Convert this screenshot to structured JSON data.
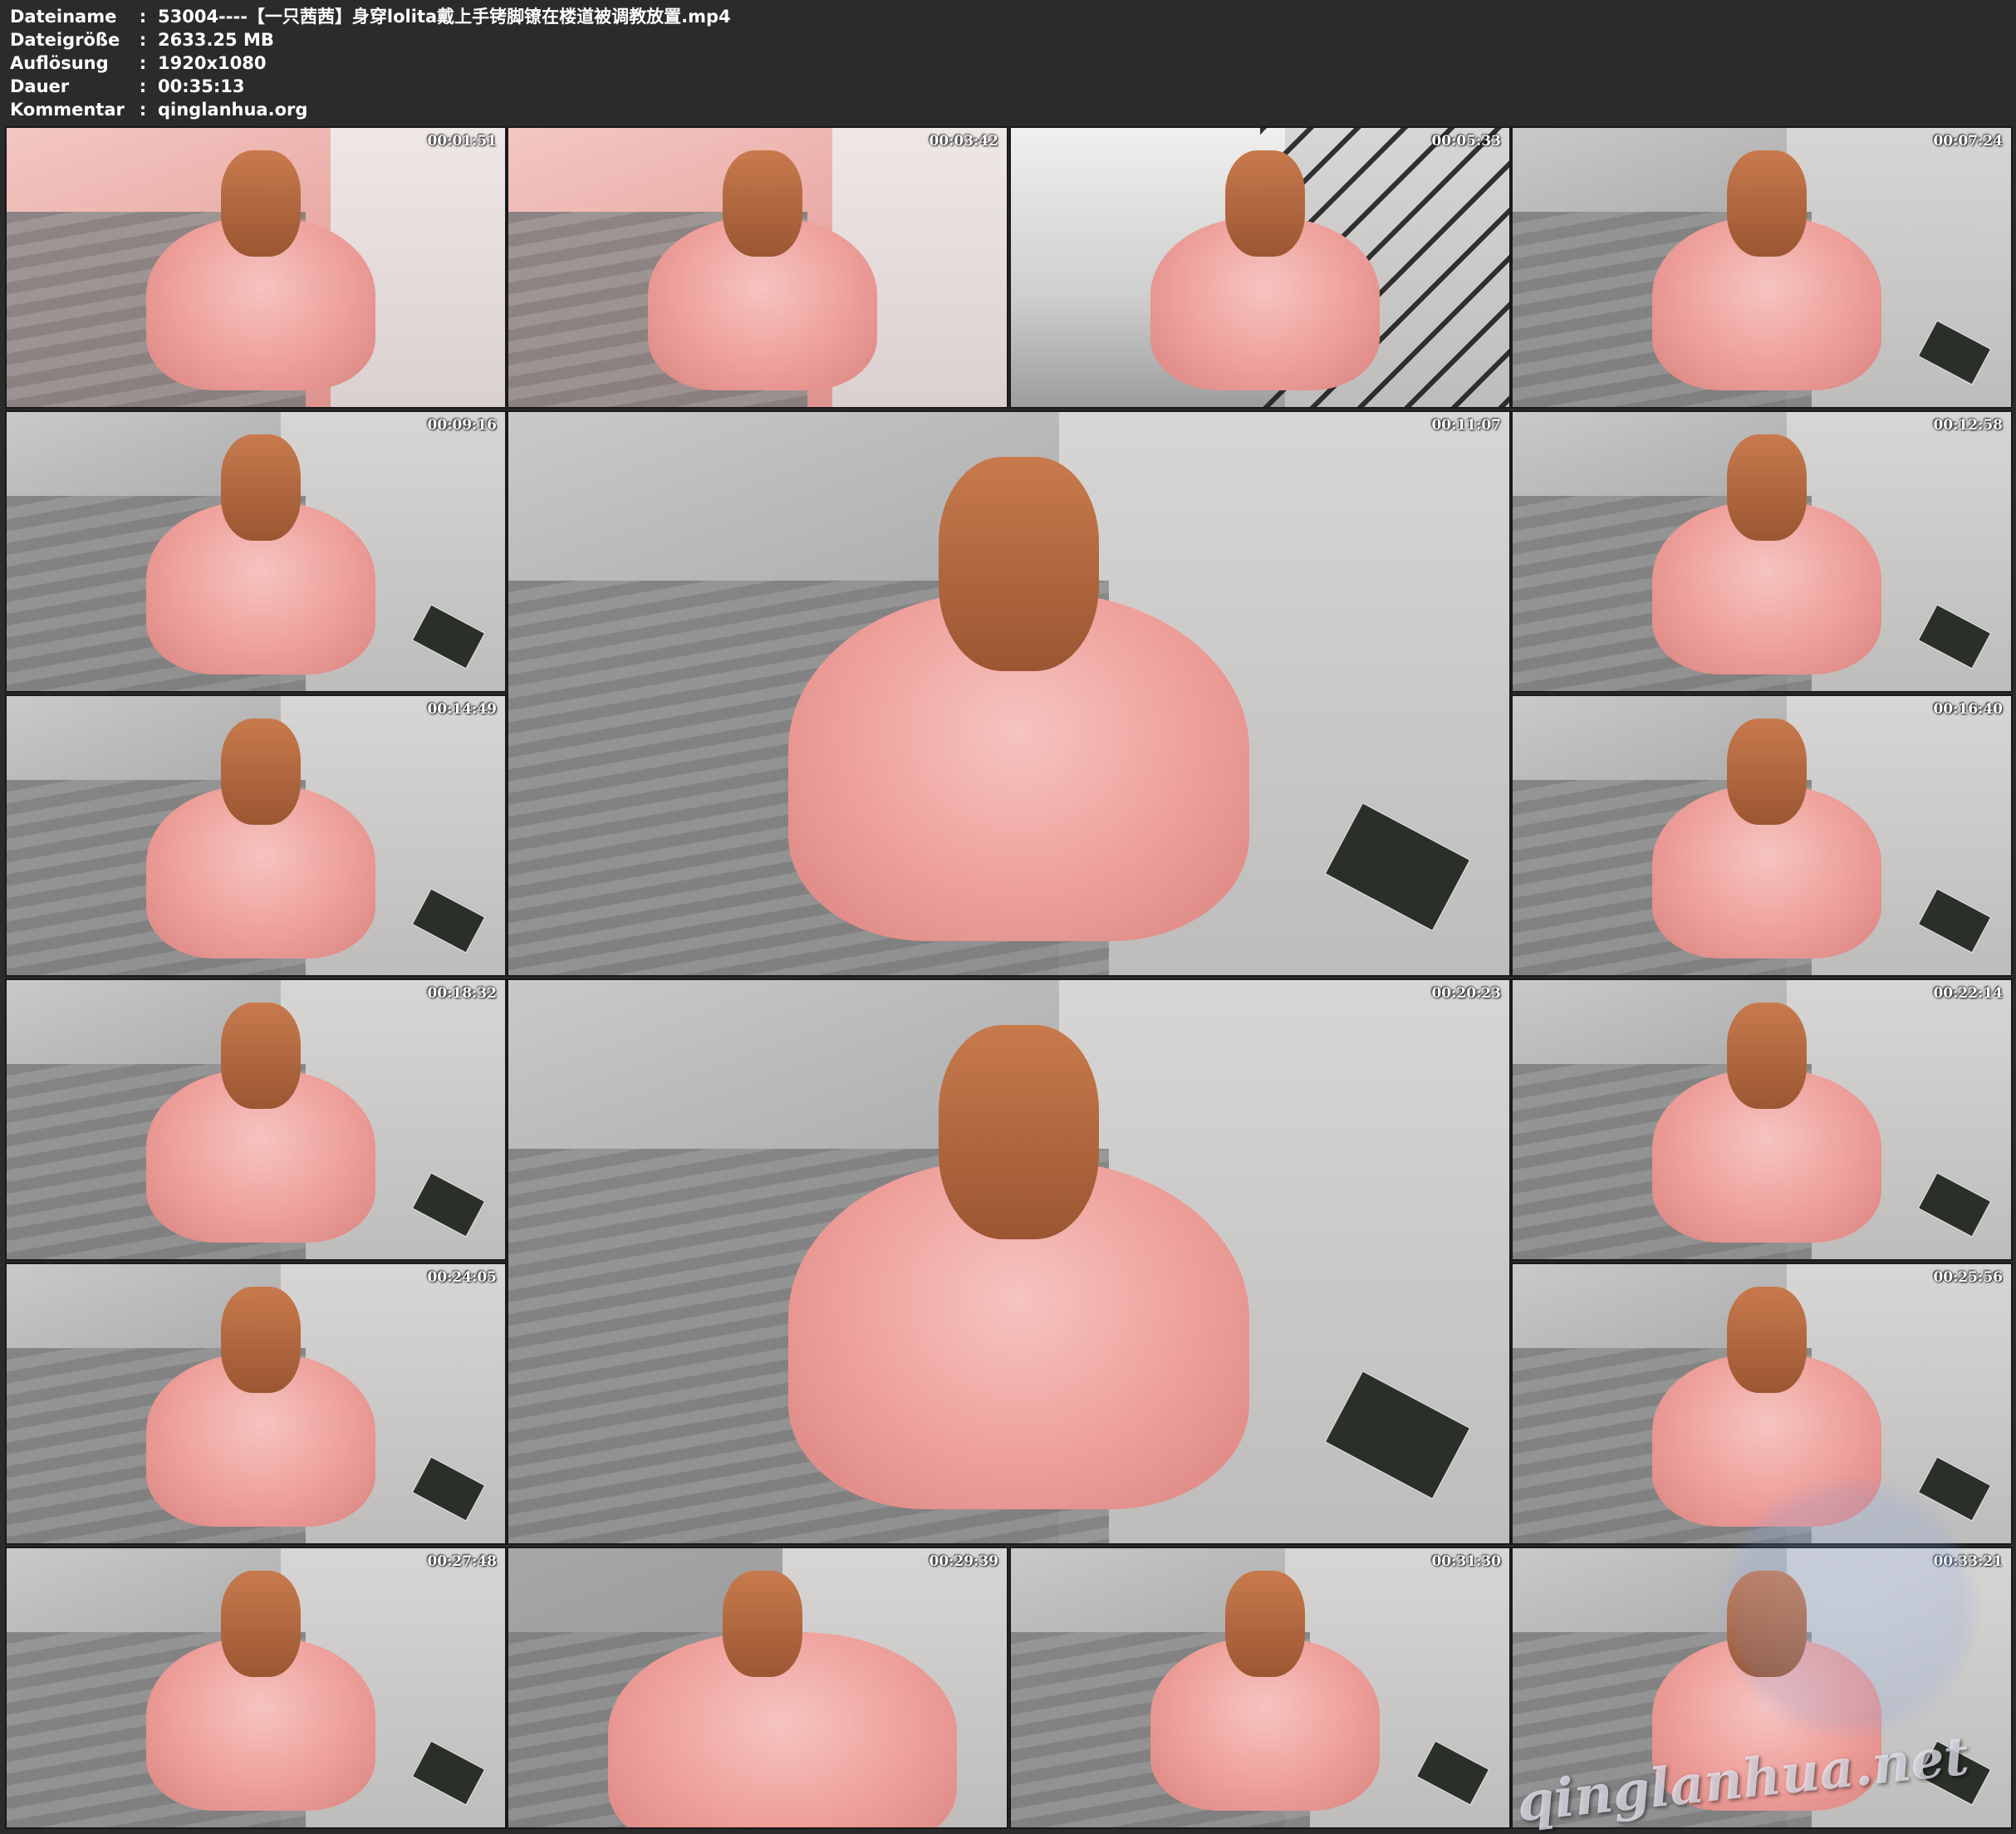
{
  "metadata": [
    {
      "key": "Dateiname",
      "value": "53004----【一只茜茜】身穿lolita戴上手铐脚镣在楼道被调教放置.mp4"
    },
    {
      "key": "Dateigröße",
      "value": "2633.25 MB"
    },
    {
      "key": "Auflösung",
      "value": "1920x1080"
    },
    {
      "key": "Dauer",
      "value": "00:35:13"
    },
    {
      "key": "Kommentar",
      "value": "qinglanhua.org"
    }
  ],
  "colon": ":",
  "thumbnails": [
    {
      "timestamp": "00:01:51",
      "style": "pinkclose"
    },
    {
      "timestamp": "00:03:42",
      "style": "pinkclose"
    },
    {
      "timestamp": "00:05:33",
      "style": "hall"
    },
    {
      "timestamp": "00:07:24",
      "style": "stair"
    },
    {
      "timestamp": "00:09:16",
      "style": "stair"
    },
    {
      "timestamp": "00:11:07",
      "style": "stair"
    },
    {
      "timestamp": "00:12:58",
      "style": "stair"
    },
    {
      "timestamp": "00:14:49",
      "style": "stair"
    },
    {
      "timestamp": "00:16:40",
      "style": "stair"
    },
    {
      "timestamp": "00:18:32",
      "style": "stair"
    },
    {
      "timestamp": "00:20:23",
      "style": "stair"
    },
    {
      "timestamp": "00:22:14",
      "style": "stair"
    },
    {
      "timestamp": "00:24:05",
      "style": "stair"
    },
    {
      "timestamp": "00:25:56",
      "style": "stair"
    },
    {
      "timestamp": "00:27:48",
      "style": "stair"
    },
    {
      "timestamp": "00:29:39",
      "style": "floor"
    },
    {
      "timestamp": "00:31:30",
      "style": "stair"
    },
    {
      "timestamp": "00:33:21",
      "style": "stair"
    }
  ],
  "watermark": "qinglanhua.net"
}
